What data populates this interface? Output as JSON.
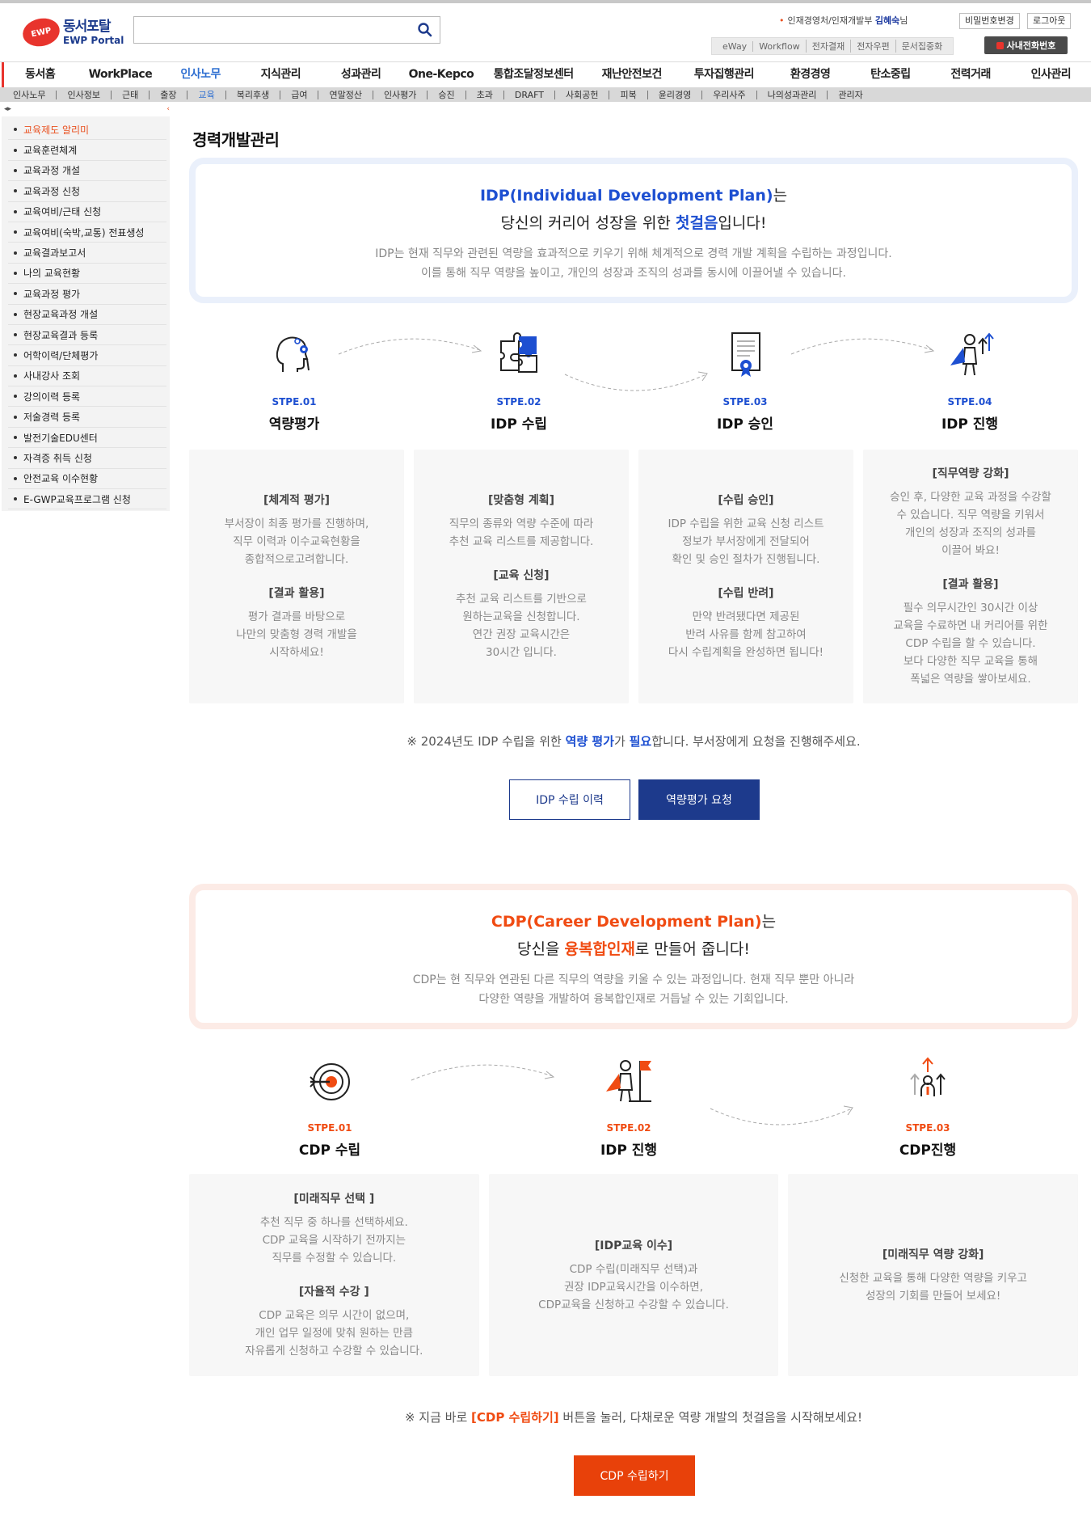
{
  "brand": {
    "logo_mark": "EWP",
    "name_kr": "동서포탈",
    "name_en": "EWP Portal"
  },
  "search": {
    "placeholder": "",
    "icon": "search-icon"
  },
  "user": {
    "dept": "인재경영처/인재개발부",
    "name": "김혜숙",
    "suffix": "님"
  },
  "header": {
    "change_password": "비밀번호변경",
    "logout": "로그아웃",
    "global_links": [
      "eWay",
      "Workflow",
      "전자결재",
      "전자우편",
      "문서집중화"
    ],
    "phone_button": "사내전화번호"
  },
  "main_nav": [
    "동서홈",
    "WorkPlace",
    "인사노무",
    "지식관리",
    "성과관리",
    "One-Kepco",
    "통합조달정보센터",
    "재난안전보건",
    "투자집행관리",
    "환경경영",
    "탄소중립",
    "전력거래",
    "인사관리"
  ],
  "main_nav_active": "인사노무",
  "sub_nav": [
    "인사노무",
    "인사정보",
    "근태",
    "출장",
    "교육",
    "복리후생",
    "급여",
    "연말정산",
    "인사평가",
    "승진",
    "초과",
    "DRAFT",
    "사회공헌",
    "피복",
    "윤리경영",
    "우리사주",
    "나의성과관리",
    "관리자"
  ],
  "sub_nav_active": "교육",
  "sidebar": {
    "active": "교육제도 알리미",
    "items": [
      "교육제도 알리미",
      "교육훈련체계",
      "교육과정 개설",
      "교육과정 신청",
      "교육여비/근태 신청",
      "교육여비(숙박,교통) 전표생성",
      "교육결과보고서",
      "나의 교육현황",
      "교육과정 평가",
      "현장교육과정 개설",
      "현장교육결과 등록",
      "어학이력/단체평가",
      "사내강사 조회",
      "강의이력 등록",
      "저술경력 등록",
      "발전기술EDU센터",
      "자격증 취득 신청",
      "안전교육 이수현황",
      "E-GWP교육프로그램 신청"
    ]
  },
  "page_title": "경력개발관리",
  "idp": {
    "heading": "IDP(Individual Development Plan)",
    "heading_suffix": "는",
    "line2_pre": "당신의 커리어 성장을 위한 ",
    "line2_em": "첫걸음",
    "line2_post": "입니다!",
    "desc1": "IDP는 현재 직무와 관련된 역량을 효과적으로 키우기 위해 체계적으로 경력 개발 계획을 수립하는 과정입니다.",
    "desc2": "이를 통해 직무 역량을 높이고, 개인의 성장과 조직의 성과를 동시에 이끌어낼 수 있습니다.",
    "steps": [
      {
        "no": "STPE.01",
        "title": "역량평가",
        "icon": "head-gear-icon"
      },
      {
        "no": "STPE.02",
        "title": "IDP 수립",
        "icon": "puzzle-icon"
      },
      {
        "no": "STPE.03",
        "title": "IDP 승인",
        "icon": "certificate-icon"
      },
      {
        "no": "STPE.04",
        "title": "IDP 진행",
        "icon": "hero-growth-icon"
      }
    ],
    "cards": [
      [
        {
          "head": "[체계적 평가]",
          "lines": [
            "부서장이 최종 평가를 진행하며,",
            "직무 이력과 이수교육현황을",
            "종합적으로고려합니다."
          ]
        },
        {
          "head": "[결과 활용]",
          "lines": [
            "평가 결과를 바탕으로",
            "나만의 맞춤형 경력 개발을",
            "시작하세요!"
          ]
        }
      ],
      [
        {
          "head": "[맞춤형 계획]",
          "lines": [
            "직무의 종류와 역량 수준에 따라",
            "추천 교육 리스트를 제공합니다."
          ]
        },
        {
          "head": "[교육 신청]",
          "lines": [
            "추천 교육 리스트를 기반으로",
            "원하는교육을 신청합니다.",
            "연간 권장 교육시간은",
            "30시간 입니다."
          ]
        }
      ],
      [
        {
          "head": "[수립 승인]",
          "lines": [
            "IDP 수립을 위한 교육 신청 리스트",
            "정보가 부서장에게 전달되어",
            "확인 및 승인 절차가 진행됩니다."
          ]
        },
        {
          "head": "[수립 반려]",
          "lines": [
            "만약 반려됐다면 제공된",
            "반려 사유를 함께 참고하여",
            "다시 수립계획을 완성하면 됩니다!"
          ]
        }
      ],
      [
        {
          "head": "[직무역량 강화]",
          "lines": [
            "승인 후, 다양한 교육 과정을 수강할",
            "수 있습니다. 직무 역량을 키워서",
            "개인의 성장과 조직의 성과를",
            "이끌어 봐요!"
          ]
        },
        {
          "head": "[결과 활용]",
          "lines": [
            "필수 의무시간인 30시간 이상",
            "교육을 수료하면 내 커리어를 위한",
            "CDP 수립을 할 수 있습니다.",
            "보다 다양한 직무 교육을 통해",
            "폭넓은 역량을 쌓아보세요."
          ]
        }
      ]
    ],
    "note_pre": "※ 2024년도 IDP 수립을 위한 ",
    "note_em1": "역량 평가",
    "note_mid": "가 ",
    "note_em2": "필요",
    "note_post": "합니다. 부서장에게 요청을 진행해주세요.",
    "btn_history": "IDP 수립 이력",
    "btn_request": "역량평가 요청"
  },
  "cdp": {
    "heading": "CDP(Career Development Plan)",
    "heading_suffix": "는",
    "line2_pre": "당신을 ",
    "line2_em": "융복합인재",
    "line2_post": "로 만들어 줍니다!",
    "desc1": "CDP는 현 직무와 연관된 다른 직무의 역량을 키울 수 있는 과정입니다. 현재 직무 뿐만 아니라",
    "desc2": "다양한 역량을 개발하여 융복합인재로 거듭날 수 있는 기회입니다.",
    "steps": [
      {
        "no": "STPE.01",
        "title": "CDP 수립",
        "icon": "target-icon"
      },
      {
        "no": "STPE.02",
        "title": "IDP 진행",
        "icon": "hero-flag-icon"
      },
      {
        "no": "STPE.03",
        "title": "CDP진행",
        "icon": "people-growth-icon"
      }
    ],
    "cards": [
      [
        {
          "head": "[미래직무 선택 ]",
          "lines": [
            "추천 직무 중 하나를 선택하세요.",
            "CDP 교육을 시작하기 전까지는",
            "직무를 수정할 수 있습니다."
          ]
        },
        {
          "head": "[자율적 수강 ]",
          "lines": [
            "CDP 교육은 의무 시간이 없으며,",
            "개인 업무 일정에 맞춰 원하는 만큼",
            "자유롭게 신청하고 수강할 수 있습니다."
          ]
        }
      ],
      [
        {
          "head": "[IDP교육 이수]",
          "lines": [
            "CDP 수립(미래직무 선택)과",
            "권장 IDP교육시간을 이수하면,",
            "CDP교육을 신청하고 수강할 수 있습니다."
          ]
        }
      ],
      [
        {
          "head": "[미래직무 역량 강화]",
          "lines": [
            "신청한 교육을 통해 다양한 역량을 키우고",
            "성장의 기회를 만들어 보세요!"
          ]
        }
      ]
    ],
    "note_pre": "※ 지금 바로 ",
    "note_em": "[CDP 수립하기]",
    "note_post": " 버튼을 눌러, 다채로운 역량 개발의 첫걸음을 시작해보세요!",
    "btn_create": "CDP 수립하기"
  },
  "colors": {
    "blue": "#1d4fd1",
    "navy": "#1d3a8c",
    "orange": "#f04b12",
    "red": "#e8342d"
  }
}
